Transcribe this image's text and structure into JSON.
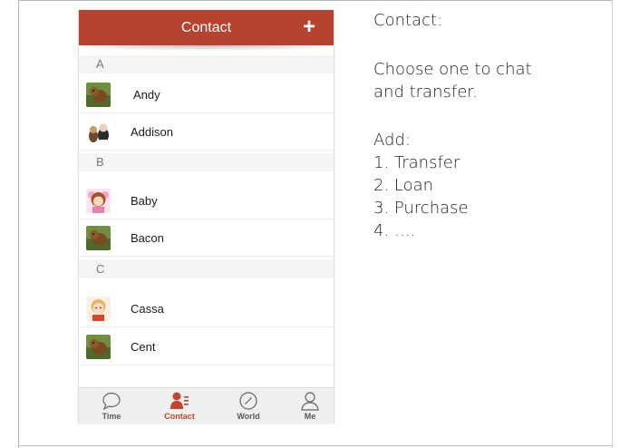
{
  "nav": {
    "title": "Contact",
    "add_label": "+"
  },
  "sections": [
    {
      "letter": "A",
      "contacts": [
        {
          "name": "Andy",
          "avatar": "squirrel-icon"
        },
        {
          "name": "Addison",
          "avatar": "dogs-icon"
        }
      ]
    },
    {
      "letter": "B",
      "contacts": [
        {
          "name": "Baby",
          "avatar": "girl-cartoon-icon"
        },
        {
          "name": "Bacon",
          "avatar": "squirrel-icon"
        }
      ]
    },
    {
      "letter": "C",
      "contacts": [
        {
          "name": "Cassa",
          "avatar": "boy-cartoon-icon"
        },
        {
          "name": "Cent",
          "avatar": "squirrel-icon"
        }
      ]
    }
  ],
  "tabs": [
    {
      "label": "Time",
      "icon": "chat-bubble-icon",
      "active": false
    },
    {
      "label": "Contact",
      "icon": "contacts-icon",
      "active": true
    },
    {
      "label": "World",
      "icon": "compass-icon",
      "active": false
    },
    {
      "label": "Me",
      "icon": "person-icon",
      "active": false
    }
  ],
  "notes": {
    "heading": "Contact:",
    "line1": "Choose one to chat",
    "line2": "and transfer.",
    "add_heading": "Add:",
    "items": [
      "1.  Transfer",
      "2.  Loan",
      "3.  Purchase",
      "4.  …."
    ]
  },
  "colors": {
    "brand": "#b5432f",
    "active_tab": "#c0462f",
    "section_bg": "#f4f5f7"
  }
}
